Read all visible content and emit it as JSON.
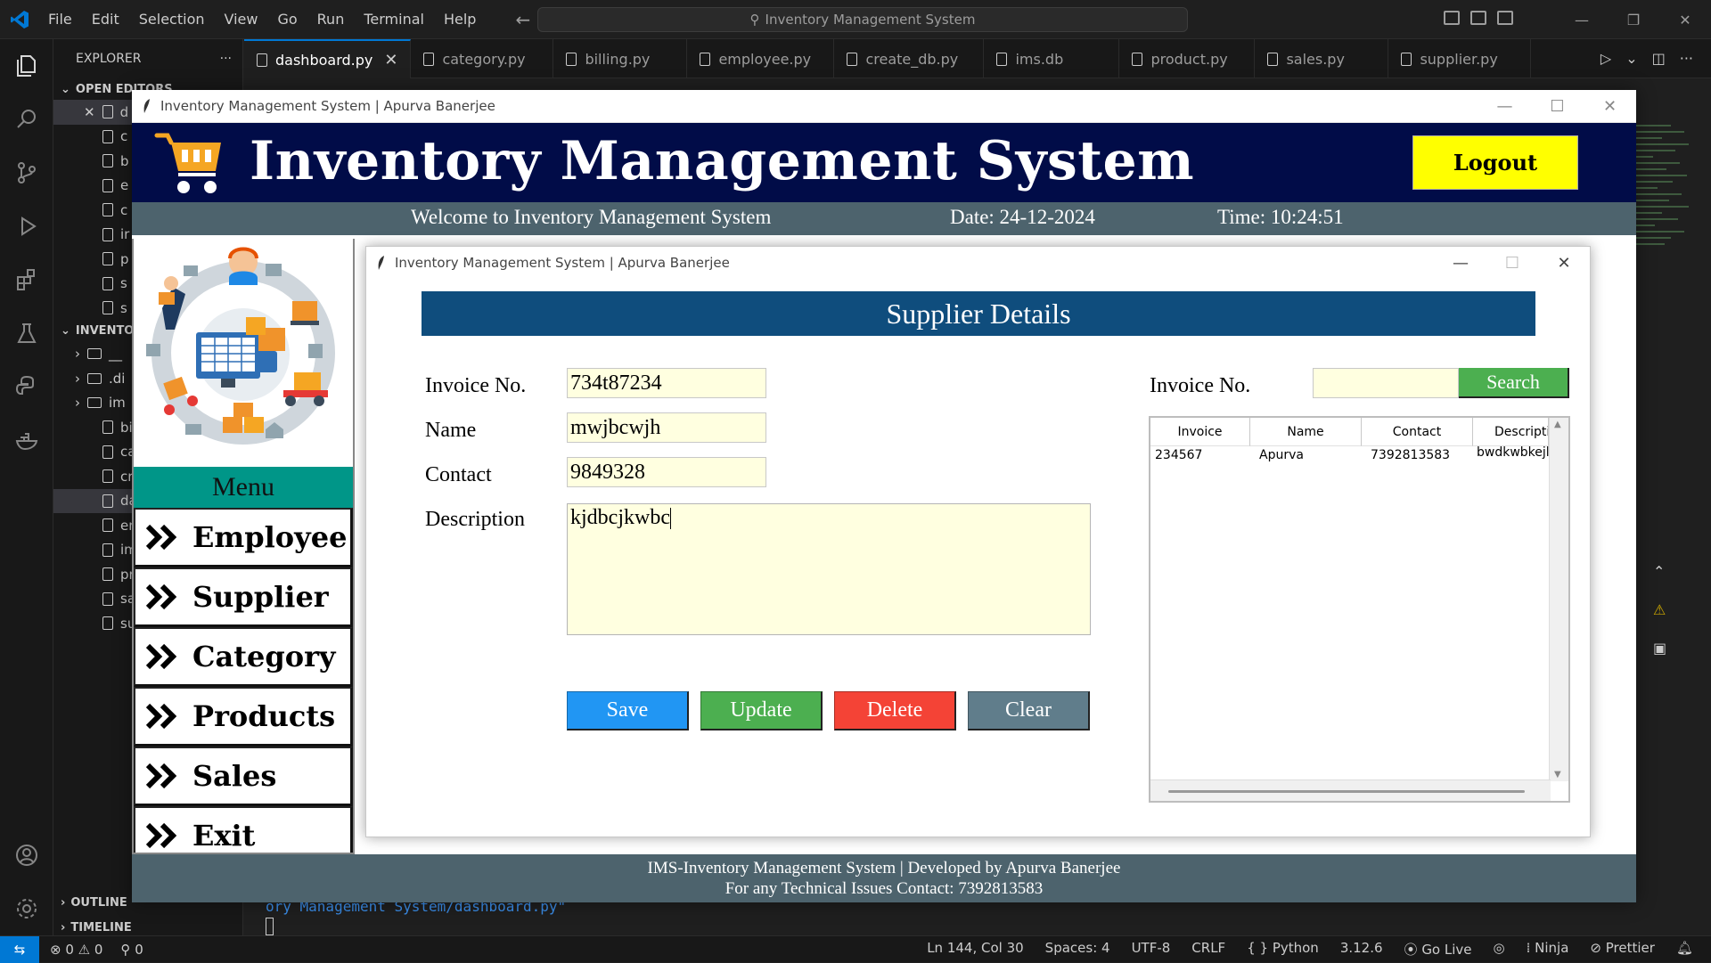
{
  "vscode": {
    "menu": [
      "File",
      "Edit",
      "Selection",
      "View",
      "Go",
      "Run",
      "Terminal",
      "Help"
    ],
    "command_center": "Inventory Management System",
    "explorer_title": "EXPLORER",
    "open_editors": "OPEN EDITORS",
    "project_section": "INVENTO",
    "outline": "OUTLINE",
    "timeline": "TIMELINE",
    "open_editor_items": [
      "d",
      "c",
      "b",
      "e",
      "c",
      "ir",
      "p",
      "s",
      "s"
    ],
    "tree_items": [
      {
        "name": "__",
        "type": "folder"
      },
      {
        "name": ".di",
        "type": "folder"
      },
      {
        "name": "im",
        "type": "folder"
      },
      {
        "name": "bil",
        "type": "file"
      },
      {
        "name": "ca",
        "type": "file"
      },
      {
        "name": "cre",
        "type": "file"
      },
      {
        "name": "da",
        "type": "file"
      },
      {
        "name": "em",
        "type": "file"
      },
      {
        "name": "im",
        "type": "file"
      },
      {
        "name": "pr",
        "type": "file"
      },
      {
        "name": "sal",
        "type": "file"
      },
      {
        "name": "su",
        "type": "file"
      }
    ],
    "tabs": [
      "dashboard.py",
      "category.py",
      "billing.py",
      "employee.py",
      "create_db.py",
      "ims.db",
      "product.py",
      "sales.py",
      "supplier.py"
    ],
    "terminal_text": "ory Management System/dashboard.py\"",
    "status": {
      "errors": "0",
      "warnings": "0",
      "ports": "0",
      "position": "Ln 144, Col 30",
      "spaces": "Spaces: 4",
      "encoding": "UTF-8",
      "eol": "CRLF",
      "language": "Python",
      "version": "3.12.6",
      "golive": "Go Live",
      "ninja": "Ninja",
      "prettier": "Prettier"
    }
  },
  "dashboard": {
    "window_title": "Inventory Management System | Apurva Banerjee",
    "title": "Inventory Management System",
    "logout": "Logout",
    "welcome": "Welcome to Inventory Management System",
    "date": "Date: 24-12-2024",
    "time": "Time: 10:24:51",
    "menu_label": "Menu",
    "menu_items": [
      "Employee",
      "Supplier",
      "Category",
      "Products",
      "Sales",
      "Exit"
    ],
    "footer_line1": "IMS-Inventory Management System | Developed by Apurva Banerjee",
    "footer_line2": "For any Technical Issues Contact: 7392813583"
  },
  "supplier": {
    "window_title": "Inventory Management System | Apurva Banerjee",
    "heading": "Supplier Details",
    "fields": {
      "invoice_label": "Invoice No.",
      "invoice_value": "734t87234",
      "name_label": "Name",
      "name_value": "mwjbcwjh",
      "contact_label": "Contact",
      "contact_value": "9849328",
      "description_label": "Description",
      "description_value": "kjdbcjkwbc"
    },
    "buttons": {
      "save": "Save",
      "update": "Update",
      "delete": "Delete",
      "clear": "Clear"
    },
    "search": {
      "label": "Invoice No.",
      "value": "",
      "button": "Search"
    },
    "table": {
      "columns": [
        "Invoice",
        "Name",
        "Contact",
        "Descripti"
      ],
      "rows": [
        [
          "234567",
          "Apurva",
          "7392813583",
          "bwdkwbkejl"
        ]
      ]
    },
    "colors": {
      "banner": "#0f4d7d",
      "save": "#2196f3",
      "update": "#4caf50",
      "delete": "#f44336",
      "clear": "#607d8b",
      "search": "#4caf50",
      "input_bg": "#ffffe0"
    }
  }
}
